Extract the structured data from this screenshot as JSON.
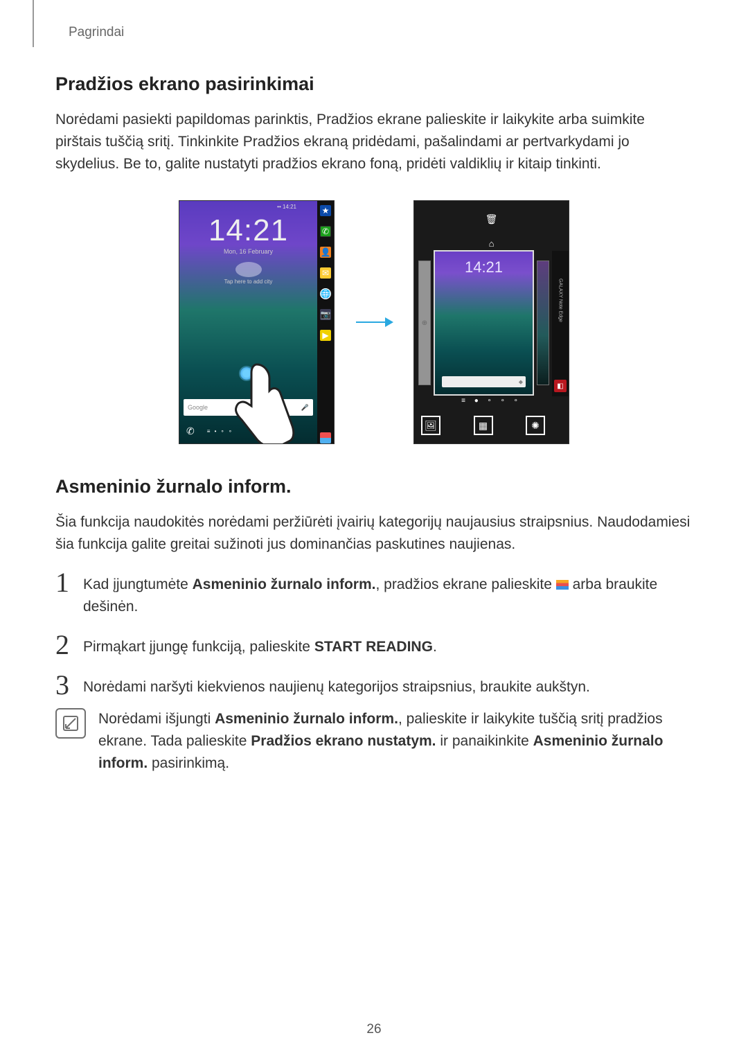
{
  "header": {
    "section": "Pagrindai"
  },
  "section1": {
    "title": "Pradžios ekrano pasirinkimai",
    "para": "Norėdami pasiekti papildomas parinktis, Pradžios ekrane palieskite ir laikykite arba suimkite pirštais tuščią sritį. Tinkinkite Pradžios ekraną pridėdami, pašalindami ar pertvarkydami jo skydelius. Be to, galite nustatyti pradžios ekrano foną, pridėti valdiklių ir kitaip tinkinti."
  },
  "figure": {
    "clock": "14:21",
    "clock_sub": "Mon, 16 February",
    "weather_sub": "Tap here to add city",
    "search_placeholder": "Google",
    "mini_clock": "14:21",
    "edge_label": "GALAXY Note Edge",
    "statusbar": "••  14:21"
  },
  "icons": {
    "trash": "trash-icon",
    "home": "home-icon",
    "wallpaper": "wallpaper-icon",
    "widgets": "widgets-icon",
    "settings": "settings-gear-icon",
    "star": "star-icon",
    "phone": "phone-icon",
    "contact": "contact-icon",
    "message": "message-icon",
    "globe": "globe-icon",
    "camera": "camera-icon",
    "play": "play-store-icon",
    "apps": "apps-grid-icon",
    "mic": "microphone-icon",
    "feed": "feed-stripes-icon",
    "note": "note-icon",
    "marker": "plus-panel-icon",
    "edge_corner": "edge-panel-icon"
  },
  "section2": {
    "title": "Asmeninio žurnalo inform.",
    "para": "Šia funkcija naudokitės norėdami peržiūrėti įvairių kategorijų naujausius straipsnius. Naudodamiesi šia funkcija galite greitai sužinoti jus dominančias paskutines naujienas.",
    "step1_a": "Kad įjungtumėte ",
    "step1_b": "Asmeninio žurnalo inform.",
    "step1_c": ", pradžios ekrane palieskite ",
    "step1_d": " arba braukite dešinėn.",
    "step2_a": "Pirmąkart įjungę funkciją, palieskite ",
    "step2_b": "START READING",
    "step2_c": ".",
    "step3": "Norėdami naršyti kiekvienos naujienų kategorijos straipsnius, braukite aukštyn.",
    "note_a": "Norėdami išjungti ",
    "note_b": "Asmeninio žurnalo inform.",
    "note_c": ", palieskite ir laikykite tuščią sritį pradžios ekrane. Tada palieskite ",
    "note_d": "Pradžios ekrano nustatym.",
    "note_e": " ir panaikinkite ",
    "note_f": "Asmeninio žurnalo inform.",
    "note_g": " pasirinkimą."
  },
  "page_number": "26"
}
